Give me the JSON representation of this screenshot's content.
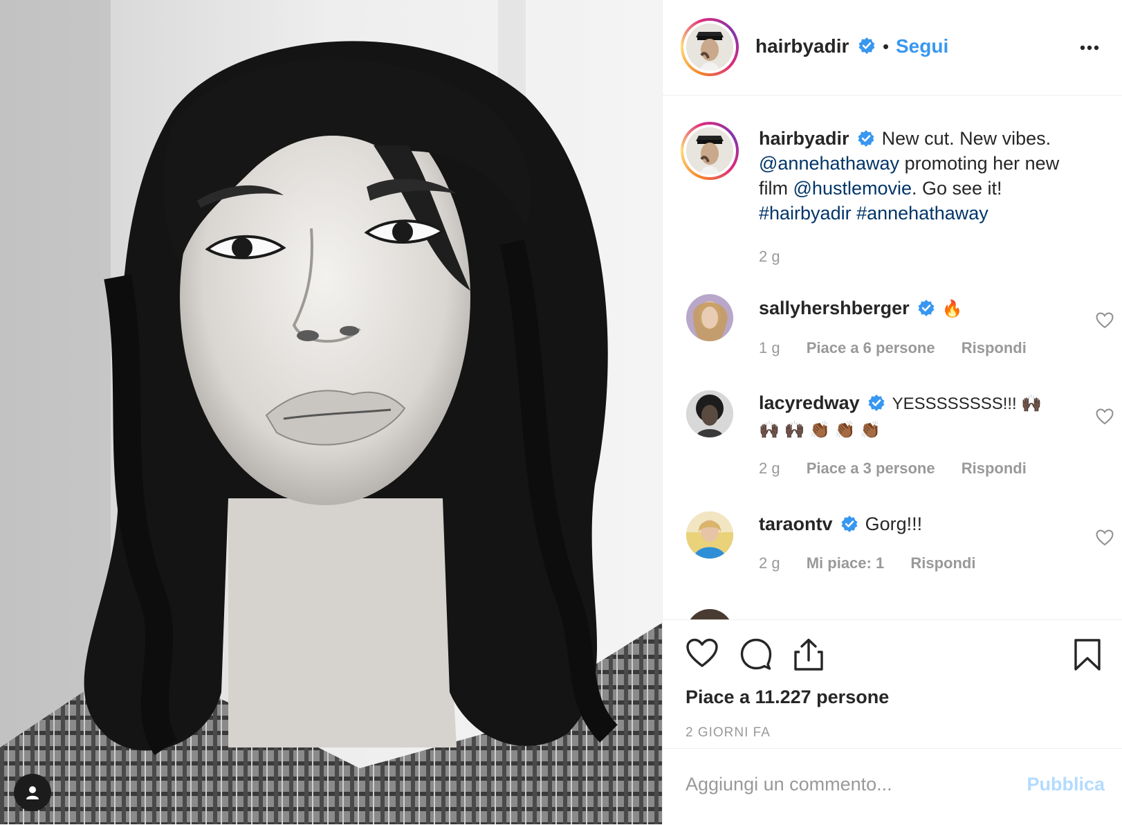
{
  "post": {
    "username": "hairbyadir",
    "follow_label": "Segui",
    "separator": "•",
    "caption": {
      "username": "hairbyadir",
      "text_1": "New cut. New vibes.",
      "mention_1": "@annehathaway",
      "text_2": "promoting her new film",
      "mention_2": "@hustlemovie",
      "text_3": ". Go see it!",
      "hashtag_1": "#hairbyadir",
      "hashtag_2": "#annehathaway",
      "time": "2 g"
    },
    "comments": [
      {
        "username": "sallyhershberger",
        "text": "🔥",
        "time": "1 g",
        "likes": "Piace a 6 persone",
        "reply": "Rispondi"
      },
      {
        "username": "lacyredway",
        "text": "YESSSSSSSS!!! 🙌🏿 🙌🏿 🙌🏿 👏🏾 👏🏾 👏🏾",
        "time": "2 g",
        "likes": "Piace a 3 persone",
        "reply": "Rispondi"
      },
      {
        "username": "taraontv",
        "text": "Gorg!!!",
        "time": "2 g",
        "likes": "Mi piace: 1",
        "reply": "Rispondi"
      }
    ],
    "likes_label": "Piace a 11.227 persone",
    "date_label": "2 GIORNI FA",
    "add_comment_placeholder": "Aggiungi un commento...",
    "publish_label": "Pubblica"
  },
  "icons": {
    "verified": "verified-badge-icon",
    "more": "more-options-icon",
    "like": "heart-icon",
    "comment": "comment-bubble-icon",
    "share": "share-icon",
    "save": "bookmark-icon",
    "tag": "user-tag-icon"
  },
  "colors": {
    "accent": "#3897f0",
    "link": "#003569",
    "muted": "#999999",
    "text": "#262626",
    "publish_disabled": "#b3dbff"
  }
}
